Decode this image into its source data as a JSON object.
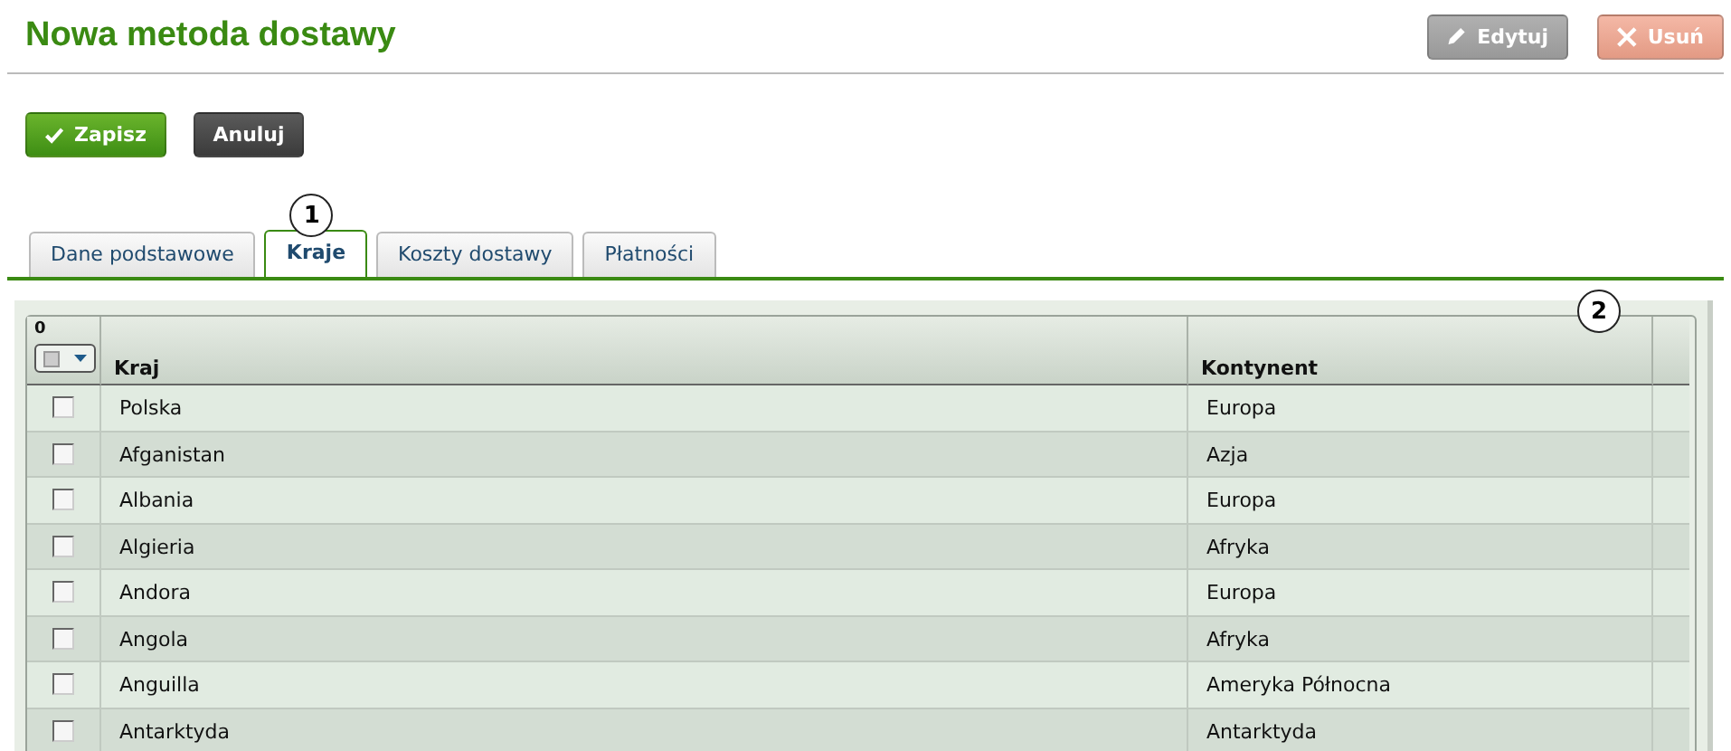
{
  "title": "Nowa metoda dostawy",
  "header_buttons": [
    {
      "label": "Edytuj",
      "kind": "edit"
    },
    {
      "label": "Usuń",
      "kind": "delete"
    }
  ],
  "form_buttons": [
    {
      "label": "Zapisz",
      "kind": "save"
    },
    {
      "label": "Anuluj",
      "kind": "cancel"
    }
  ],
  "tabs": [
    {
      "label": "Dane podstawowe",
      "selected": false
    },
    {
      "label": "Kraje",
      "selected": true
    },
    {
      "label": "Koszty dostawy",
      "selected": false
    },
    {
      "label": "Płatności",
      "selected": false
    }
  ],
  "callouts": [
    "1",
    "2"
  ],
  "table": {
    "selected_count": "0",
    "columns": [
      "Kraj",
      "Kontynent"
    ],
    "rows": [
      {
        "checked": false,
        "cells": [
          "Polska",
          "Europa"
        ]
      },
      {
        "checked": false,
        "cells": [
          "Afganistan",
          "Azja"
        ]
      },
      {
        "checked": false,
        "cells": [
          "Albania",
          "Europa"
        ]
      },
      {
        "checked": false,
        "cells": [
          "Algieria",
          "Afryka"
        ]
      },
      {
        "checked": false,
        "cells": [
          "Andora",
          "Europa"
        ]
      },
      {
        "checked": false,
        "cells": [
          "Angola",
          "Afryka"
        ]
      },
      {
        "checked": false,
        "cells": [
          "Anguilla",
          "Ameryka Północna"
        ]
      },
      {
        "checked": false,
        "cells": [
          "Antarktyda",
          "Antarktyda"
        ]
      }
    ]
  }
}
